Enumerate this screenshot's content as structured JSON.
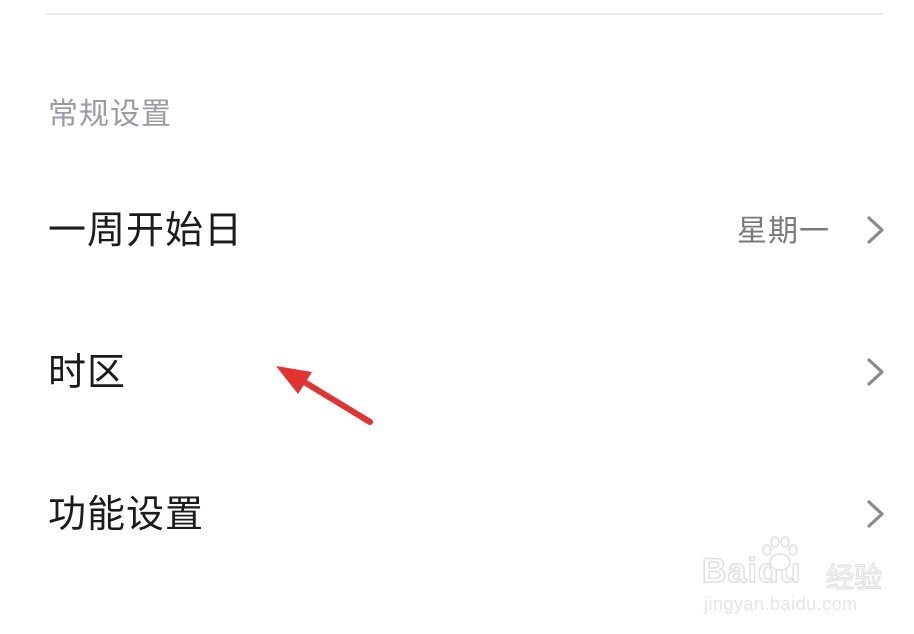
{
  "section": {
    "title": "常规设置"
  },
  "rows": [
    {
      "label": "一周开始日",
      "value": "星期一",
      "icon": "chevron-right-icon"
    },
    {
      "label": "时区",
      "value": "",
      "icon": "chevron-right-icon"
    },
    {
      "label": "功能设置",
      "value": "",
      "icon": "chevron-right-icon"
    }
  ],
  "annotation": {
    "icon": "red-arrow-icon",
    "color": "#e23232"
  },
  "watermark": {
    "brand": "Baidu",
    "sub": "经验",
    "url": "jingyan.baidu.com"
  },
  "colors": {
    "section_header": "#9a9aa8",
    "label": "#1b1b1b",
    "value": "#7a7a7a",
    "chevron": "#8a8a8a",
    "divider": "#ececee"
  }
}
